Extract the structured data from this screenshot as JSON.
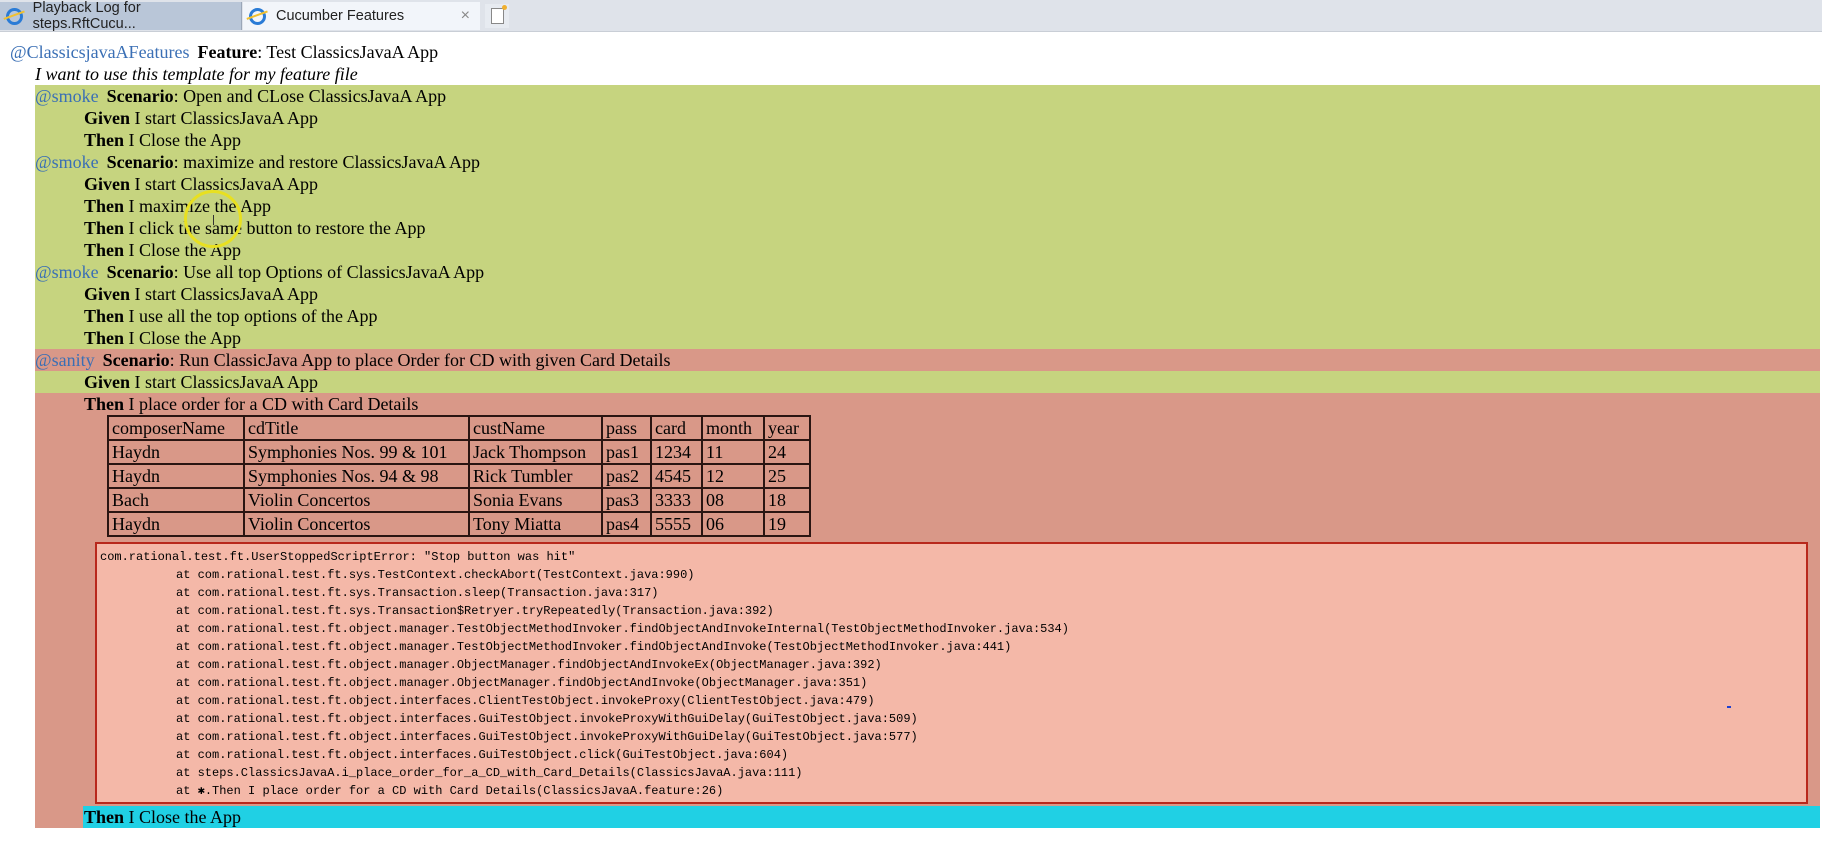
{
  "tabs": [
    {
      "label": "Playback Log for steps.RftCucu...",
      "icon": "ie-icon",
      "active": false
    },
    {
      "label": "Cucumber Features",
      "icon": "ie-icon",
      "active": true,
      "close": "×"
    }
  ],
  "feature": {
    "tag": "@ClassicsjavaAFeatures",
    "keyword": "Feature",
    "title": "Test ClassicsJavaA App",
    "description": "I want to use this template for my feature file"
  },
  "colors": {
    "passed": "#c6d47f",
    "failed": "#d99888",
    "skipped": "#20d0e4",
    "tag": "#3a6fb5"
  },
  "scenarios": [
    {
      "tag": "@smoke",
      "keyword": "Scenario",
      "name": "Open and CLose ClassicsJavaA App",
      "status": "passed",
      "steps": [
        {
          "keyword": "Given",
          "text": "I start ClassicsJavaA App",
          "status": "passed"
        },
        {
          "keyword": "Then",
          "text": "I Close the App",
          "status": "passed"
        }
      ]
    },
    {
      "tag": "@smoke",
      "keyword": "Scenario",
      "name": "maximize and restore ClassicsJavaA App",
      "status": "passed",
      "steps": [
        {
          "keyword": "Given",
          "text": "I start ClassicsJavaA App",
          "status": "passed"
        },
        {
          "keyword": "Then",
          "text": "I maximize the App",
          "status": "passed"
        },
        {
          "keyword": "Then",
          "text": "I click the same button to restore the App",
          "status": "passed"
        },
        {
          "keyword": "Then",
          "text": "I Close the App",
          "status": "passed"
        }
      ]
    },
    {
      "tag": "@smoke",
      "keyword": "Scenario",
      "name": "Use all top Options of ClassicsJavaA App",
      "status": "passed",
      "steps": [
        {
          "keyword": "Given",
          "text": "I start ClassicsJavaA App",
          "status": "passed"
        },
        {
          "keyword": "Then",
          "text": "I use all the top options of the App",
          "status": "passed"
        },
        {
          "keyword": "Then",
          "text": "I Close the App",
          "status": "passed"
        }
      ]
    },
    {
      "tag": "@sanity",
      "keyword": "Scenario",
      "name": "Run ClassicJava App to place Order for CD with given Card Details",
      "status": "failed",
      "steps": [
        {
          "keyword": "Given",
          "text": "I start ClassicsJavaA App",
          "status": "passed"
        },
        {
          "keyword": "Then",
          "text": "I place order for a CD with Card Details",
          "status": "failed",
          "table": {
            "header": [
              "composerName",
              "cdTitle",
              "custName",
              "pass",
              "card",
              "month",
              "year"
            ],
            "rows": [
              [
                "Haydn",
                "Symphonies Nos. 99 & 101",
                "Jack Thompson",
                "pas1",
                "1234",
                "11",
                "24"
              ],
              [
                "Haydn",
                "Symphonies Nos. 94 & 98",
                "Rick Tumbler",
                "pas2",
                "4545",
                "12",
                "25"
              ],
              [
                "Bach",
                "Violin Concertos",
                "Sonia Evans",
                "pas3",
                "3333",
                "08",
                "18"
              ],
              [
                "Haydn",
                "Violin Concertos",
                "Tony Miatta",
                "pas4",
                "5555",
                "06",
                "19"
              ]
            ]
          },
          "error": [
            "com.rational.test.ft.UserStoppedScriptError: \"Stop button was hit\"",
            "at com.rational.test.ft.sys.TestContext.checkAbort(TestContext.java:990)",
            "at com.rational.test.ft.sys.Transaction.sleep(Transaction.java:317)",
            "at com.rational.test.ft.sys.Transaction$Retryer.tryRepeatedly(Transaction.java:392)",
            "at com.rational.test.ft.object.manager.TestObjectMethodInvoker.findObjectAndInvokeInternal(TestObjectMethodInvoker.java:534)",
            "at com.rational.test.ft.object.manager.TestObjectMethodInvoker.findObjectAndInvoke(TestObjectMethodInvoker.java:441)",
            "at com.rational.test.ft.object.manager.ObjectManager.findObjectAndInvokeEx(ObjectManager.java:392)",
            "at com.rational.test.ft.object.manager.ObjectManager.findObjectAndInvoke(ObjectManager.java:351)",
            "at com.rational.test.ft.object.interfaces.ClientTestObject.invokeProxy(ClientTestObject.java:479)",
            "at com.rational.test.ft.object.interfaces.GuiTestObject.invokeProxyWithGuiDelay(GuiTestObject.java:509)",
            "at com.rational.test.ft.object.interfaces.GuiTestObject.invokeProxyWithGuiDelay(GuiTestObject.java:577)",
            "at com.rational.test.ft.object.interfaces.GuiTestObject.click(GuiTestObject.java:604)",
            "at steps.ClassicsJavaA.i_place_order_for_a_CD_with_Card_Details(ClassicsJavaA.java:111)",
            "at ✱.Then I place order for a CD with Card Details(ClassicsJavaA.feature:26)"
          ]
        },
        {
          "keyword": "Then",
          "text": "I Close the App",
          "status": "skipped"
        }
      ]
    }
  ]
}
